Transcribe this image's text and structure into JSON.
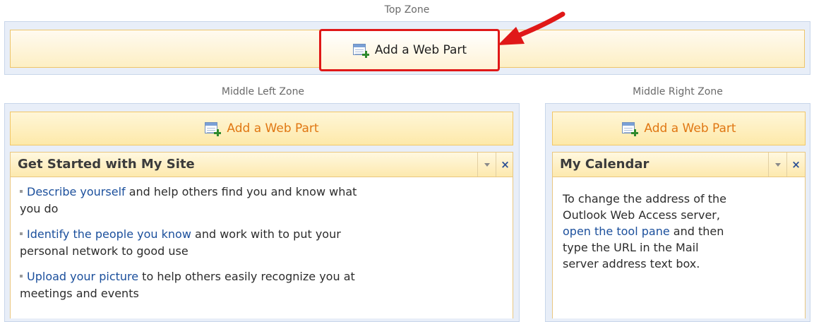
{
  "top_zone": {
    "label": "Top Zone",
    "add_web_part_label": "Add a Web Part"
  },
  "middle_left_zone": {
    "label": "Middle Left Zone",
    "add_web_part_label": "Add a Web Part",
    "web_part": {
      "title": "Get Started with My Site",
      "items": [
        {
          "link": "Describe yourself",
          "line1": " and help others find you and know what",
          "line2": "you do"
        },
        {
          "link": "Identify the people you know",
          "line1": " and work with to put your",
          "line2": "personal network to good use"
        },
        {
          "link": "Upload your picture",
          "line1": " to help others easily recognize you at",
          "line2": "meetings and events"
        }
      ]
    }
  },
  "middle_right_zone": {
    "label": "Middle Right Zone",
    "add_web_part_label": "Add a Web Part",
    "web_part": {
      "title": "My Calendar",
      "text_line1": "To change the address of the",
      "text_line2": "Outlook Web Access server,",
      "text_link": "open the tool pane",
      "text_line3_rest": " and then",
      "text_line4": "type the URL in the Mail",
      "text_line5": "server address text box."
    }
  },
  "colors": {
    "highlight": "#e01818",
    "link": "#1b4f9c",
    "add_text": "#e07713"
  },
  "icons": {
    "add_web_part": "add-web-part-icon",
    "menu": "chevron-down-icon",
    "close": "close-icon",
    "arrow": "red-arrow-annotation"
  }
}
